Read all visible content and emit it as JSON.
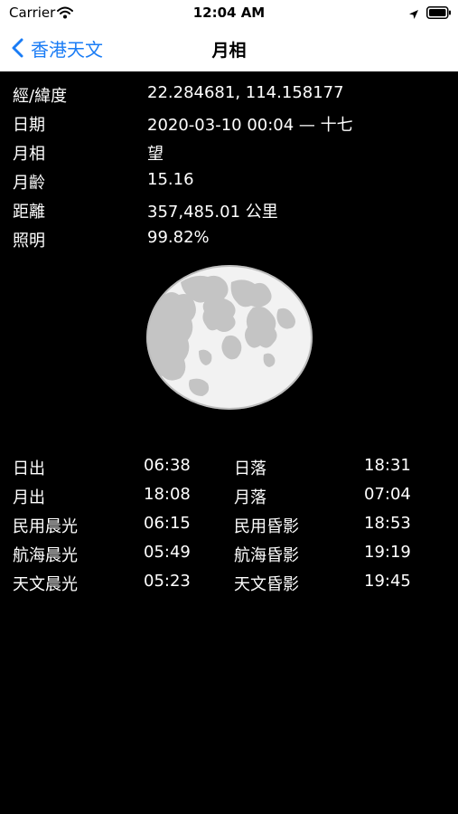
{
  "status_bar": {
    "carrier": "Carrier",
    "time": "12:04 AM"
  },
  "nav": {
    "back_label": "香港天文",
    "title": "月相"
  },
  "info": [
    {
      "label": "經/緯度",
      "value": "22.284681, 114.158177"
    },
    {
      "label": "日期",
      "value": "2020-03-10 00:04 — 十七"
    },
    {
      "label": "月相",
      "value": "望"
    },
    {
      "label": "月齡",
      "value": "15.16"
    },
    {
      "label": "距離",
      "value": "357,485.01 公里"
    },
    {
      "label": "照明",
      "value": "99.82%"
    }
  ],
  "moon_illumination": 0.9982,
  "times": [
    {
      "label1": "日出",
      "value1": "06:38",
      "label2": "日落",
      "value2": "18:31"
    },
    {
      "label1": "月出",
      "value1": "18:08",
      "label2": "月落",
      "value2": "07:04"
    },
    {
      "label1": "民用晨光",
      "value1": "06:15",
      "label2": "民用昏影",
      "value2": "18:53"
    },
    {
      "label1": "航海晨光",
      "value1": "05:49",
      "label2": "航海昏影",
      "value2": "19:19"
    },
    {
      "label1": "天文晨光",
      "value1": "05:23",
      "label2": "天文昏影",
      "value2": "19:45"
    }
  ],
  "colors": {
    "background": "#000000",
    "bar": "#ffffff",
    "accent": "#1a7cf5",
    "moon_light": "#f2f2f2",
    "moon_dark": "#c4c4c4"
  }
}
